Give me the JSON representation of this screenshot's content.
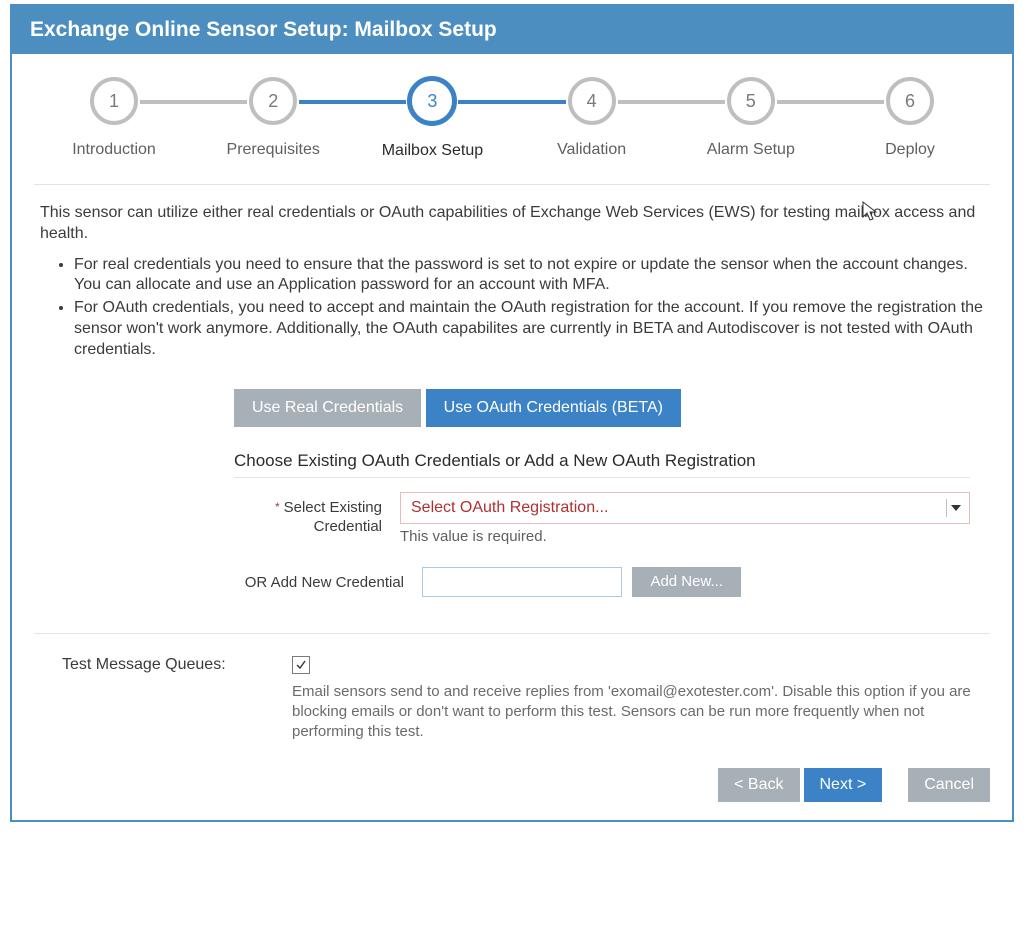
{
  "header": {
    "title": "Exchange Online Sensor Setup: Mailbox Setup"
  },
  "stepper": {
    "activeIndex": 2,
    "steps": [
      {
        "num": "1",
        "label": "Introduction"
      },
      {
        "num": "2",
        "label": "Prerequisites"
      },
      {
        "num": "3",
        "label": "Mailbox Setup"
      },
      {
        "num": "4",
        "label": "Validation"
      },
      {
        "num": "5",
        "label": "Alarm Setup"
      },
      {
        "num": "6",
        "label": "Deploy"
      }
    ]
  },
  "intro": "This sensor can utilize either real credentials or OAuth capabilities of Exchange Web Services (EWS) for testing mailbox access and health.",
  "bullets": [
    "For real credentials you need to ensure that the password is set to not expire or update the sensor when the account changes. You can allocate and use an Application password for an account with MFA.",
    "For OAuth credentials, you need to accept and maintain the OAuth registration for the account. If you remove the registration the sensor won't work anymore. Additionally, the OAuth capabilites are currently in BETA and Autodiscover is not tested with OAuth credentials."
  ],
  "tabs": {
    "real": "Use Real Credentials",
    "oauth": "Use OAuth Credentials (BETA)"
  },
  "section": {
    "title": "Choose Existing OAuth Credentials or Add a New OAuth Registration",
    "selectLabel": "Select Existing Credential",
    "selectPlaceholder": "Select OAuth Registration...",
    "selectError": "This value is required.",
    "addLabel": "OR Add New Credential",
    "addNewBtn": "Add New..."
  },
  "queues": {
    "label": "Test Message Queues:",
    "checked": true,
    "desc": "Email sensors send to and receive replies from 'exomail@exotester.com'. Disable this option if you are blocking emails or don't want to perform this test. Sensors can be run more frequently when not performing this test."
  },
  "footer": {
    "back": "< Back",
    "next": "Next >",
    "cancel": "Cancel"
  }
}
